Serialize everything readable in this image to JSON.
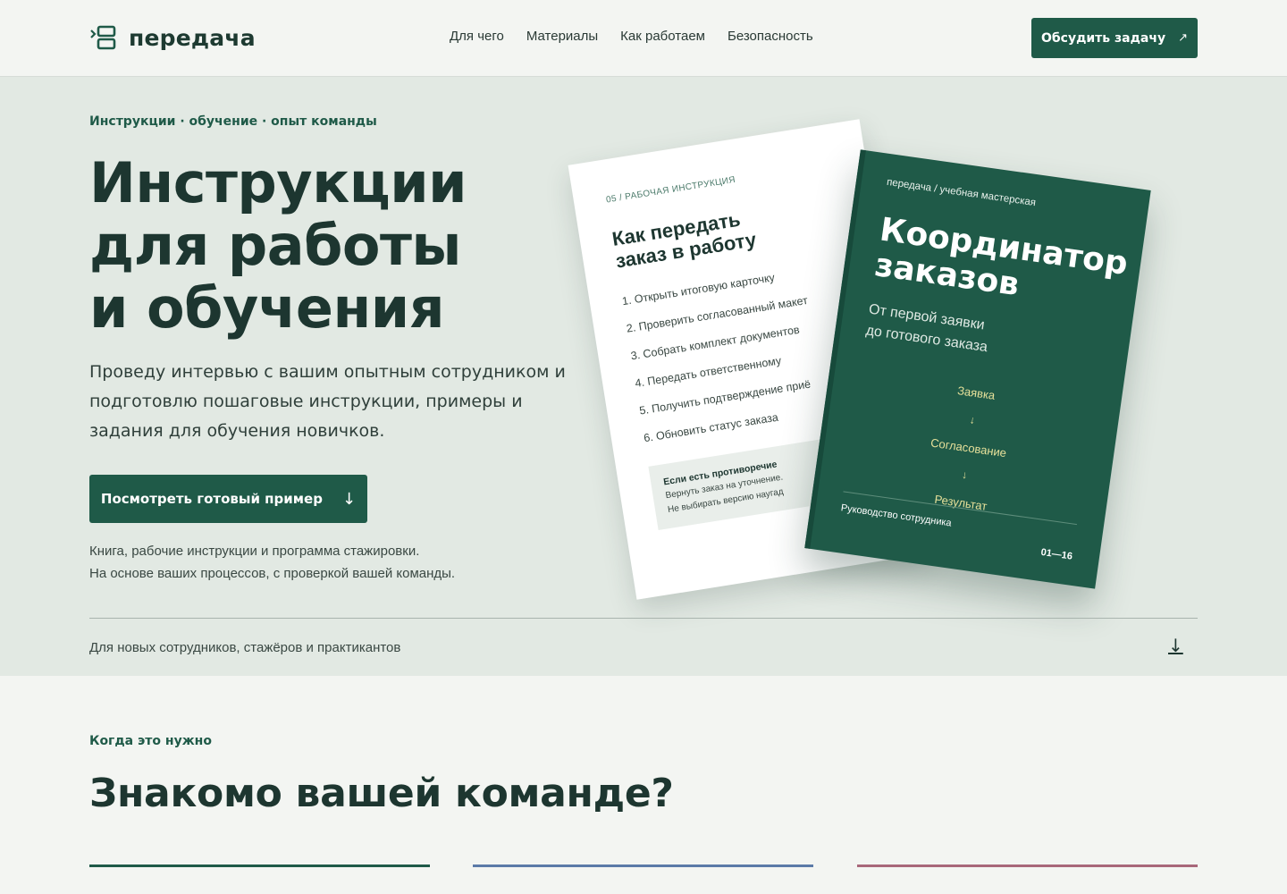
{
  "header": {
    "logo_text": "передача",
    "nav": [
      "Для чего",
      "Материалы",
      "Как работаем",
      "Безопасность"
    ],
    "cta_label": "Обсудить задачу",
    "cta_icon": "arrow-up-right-icon"
  },
  "hero": {
    "eyebrow": "Инструкции · обучение · опыт команды",
    "title_lines": [
      "Инструкции",
      "для работы",
      "и обучения"
    ],
    "lead": "Проведу интервью с вашим опытным сотрудником и подготовлю пошаговые инструкции, примеры и задания для обучения новичков.",
    "button_label": "Посмотреть готовый пример",
    "button_icon": "arrow-down-icon",
    "note_lines": [
      "Книга, рабочие инструкции и программа стажировки.",
      "На основе ваших процессов, с проверкой вашей команды."
    ],
    "audience": "Для новых сотрудников, стажёров и практикантов"
  },
  "sheet": {
    "kicker": "05 / РАБОЧАЯ ИНСТРУКЦИЯ",
    "title": "Как передать заказ в работу",
    "steps": [
      "1. Открыть итоговую карточку",
      "2. Проверить согласованный макет",
      "3. Собрать комплект документов",
      "4. Передать ответственному",
      "5. Получить подтверждение приё",
      "6. Обновить статус заказа"
    ],
    "box_title": "Если есть противоречие",
    "box_lines": [
      "Вернуть заказ на уточнение.",
      "Не выбирать версию наугад"
    ]
  },
  "book": {
    "kicker": "передача / учебная мастерская",
    "title_lines": [
      "Координатор",
      "заказов"
    ],
    "subtitle_lines": [
      "От первой заявки",
      "до готового заказа"
    ],
    "flow": [
      "Заявка",
      "Согласование",
      "Результат"
    ],
    "footer": "Руководство сотрудника",
    "pages": "01—16"
  },
  "section2": {
    "eyebrow": "Когда это нужно",
    "title": "Знакомо вашей команде?",
    "card_colors": [
      "#1f5a48",
      "#5b7aa8",
      "#a8687a"
    ]
  },
  "colors": {
    "accent": "#1f5a48",
    "hero_bg": "#e2e9e3",
    "page_bg": "#f3f5f2",
    "flow_text": "#e6e09a"
  }
}
